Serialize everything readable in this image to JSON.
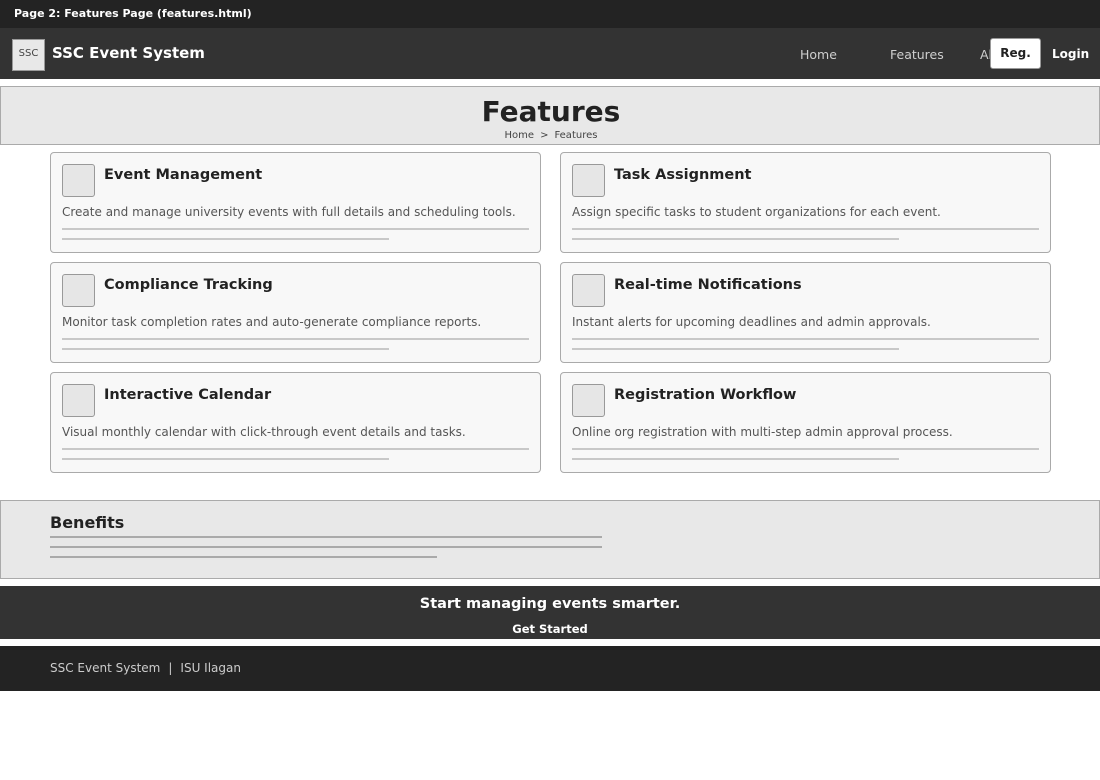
{
  "page_label": "Page 2: Features Page (features.html)",
  "nav": {
    "logo_text": "SSC",
    "brand": "SSC Event System",
    "links": [
      "Home",
      "Features",
      "About"
    ],
    "register_label": "Reg.",
    "login_label": "Login"
  },
  "hero": {
    "title": "Features",
    "breadcrumb": [
      "Home",
      "Features"
    ],
    "breadcrumb_separator": ">"
  },
  "features": [
    {
      "title": "Event Management",
      "description": "Create and manage university events with full details and scheduling tools."
    },
    {
      "title": "Task Assignment",
      "description": "Assign specific tasks to student organizations for each event."
    },
    {
      "title": "Compliance Tracking",
      "description": "Monitor task completion rates and auto-generate compliance reports."
    },
    {
      "title": "Real-time Notifications",
      "description": "Instant alerts for upcoming deadlines and admin approvals."
    },
    {
      "title": "Interactive Calendar",
      "description": "Visual monthly calendar with click-through event details and tasks."
    },
    {
      "title": "Registration Workflow",
      "description": "Online org registration with multi-step admin approval process."
    }
  ],
  "benefits": {
    "title": "Benefits"
  },
  "cta": {
    "title": "Start managing events smarter.",
    "button": "Get Started"
  },
  "footer": {
    "left": "SSC Event System",
    "separator": "|",
    "right": "ISU Ilagan"
  },
  "colors": {
    "dark_bar": "#232323",
    "nav_bg": "#333333",
    "panel_bg": "#e8e8e8",
    "card_bg": "#f8f8f8"
  }
}
